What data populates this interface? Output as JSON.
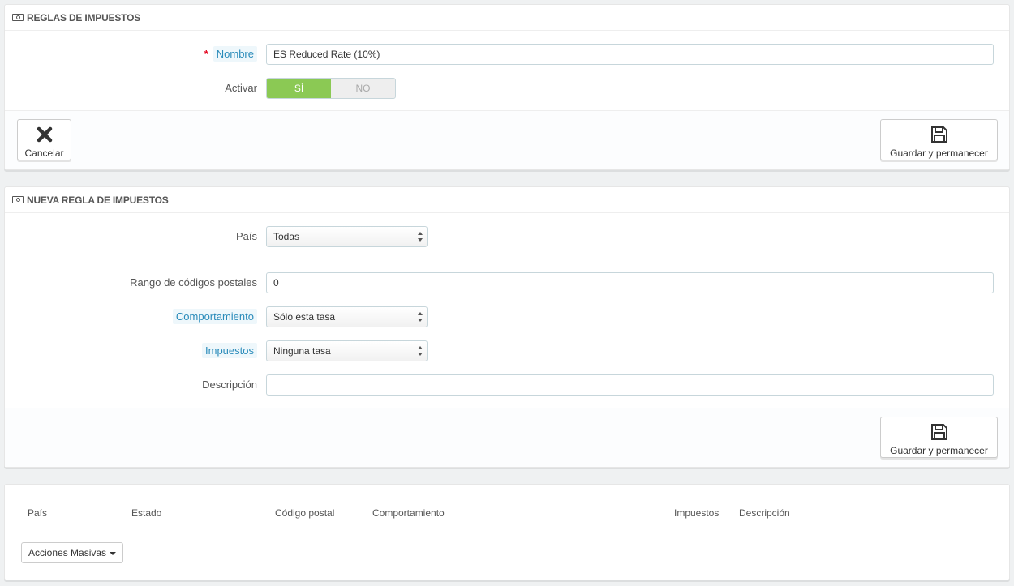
{
  "rules_panel": {
    "title": "REGLAS DE IMPUESTOS",
    "name_label": "Nombre",
    "name_required_mark": "*",
    "name_value": "ES Reduced Rate (10%)",
    "active_label": "Activar",
    "active_yes": "SÍ",
    "active_no": "NO",
    "active_selected": "yes",
    "cancel_label": "Cancelar",
    "save_stay_label": "Guardar y permanecer"
  },
  "new_rule_panel": {
    "title": "NUEVA REGLA DE IMPUESTOS",
    "country_label": "País",
    "country_value": "Todas",
    "zip_label": "Rango de códigos postales",
    "zip_value": "0",
    "behavior_label": "Comportamiento",
    "behavior_value": "Sólo esta tasa",
    "tax_label": "Impuestos",
    "tax_value": "Ninguna tasa",
    "description_label": "Descripción",
    "description_value": "",
    "save_stay_label": "Guardar y permanecer"
  },
  "list_panel": {
    "columns": [
      "País",
      "Estado",
      "Código postal",
      "Comportamiento",
      "Impuestos",
      "Descripción"
    ],
    "bulk_actions_label": "Acciones Masivas"
  },
  "colors": {
    "switch_on": "#8bc954",
    "hint_text": "#2a8bba",
    "required": "#e3001b"
  },
  "icons": {
    "heading": "money-icon",
    "cancel": "close-icon",
    "save": "floppy-disk-icon"
  }
}
